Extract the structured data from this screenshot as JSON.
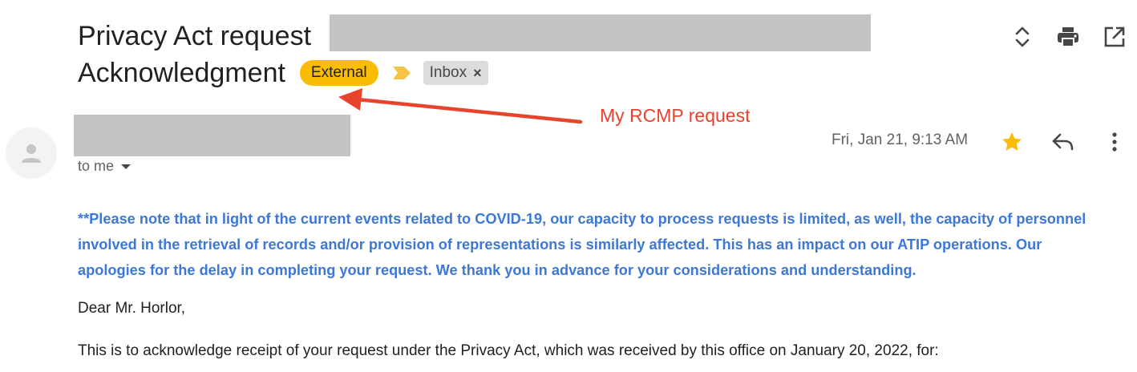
{
  "subject": {
    "line1": "Privacy Act request",
    "line2": "Acknowledgment"
  },
  "labels": {
    "external": "External",
    "inbox": "Inbox",
    "inbox_remove": "×"
  },
  "toolbar": {
    "icons": [
      "expand-collapse-icon",
      "print-icon",
      "open-in-new-window-icon"
    ]
  },
  "annotation": {
    "text": "My RCMP request",
    "color": "#e8432c"
  },
  "sender": {
    "recipient": "to me",
    "date": "Fri, Jan 21, 9:13 AM"
  },
  "message_actions": {
    "icons": [
      "star-icon",
      "reply-icon",
      "more-options-icon"
    ],
    "star_color": "#fbbc04"
  },
  "body": {
    "notice": "**Please note that in light of the current events related to COVID-19, our capacity to process requests is limited, as well, the capacity of personnel involved in the retrieval of records and/or provision of representations is similarly affected. This has an impact on our ATIP operations. Our apologies for the delay in completing your request. We thank you in advance for your considerations and understanding.",
    "notice_color": "#3c78d8",
    "greeting": "Dear Mr. Horlor,",
    "acknowledgment": "This is to acknowledge receipt of your request under the Privacy Act, which was received by this office on January 20, 2022, for:"
  },
  "colors": {
    "external_label": "#fbbc04",
    "inbox_label": "#dcdcdc",
    "redaction": "#c3c3c3"
  }
}
